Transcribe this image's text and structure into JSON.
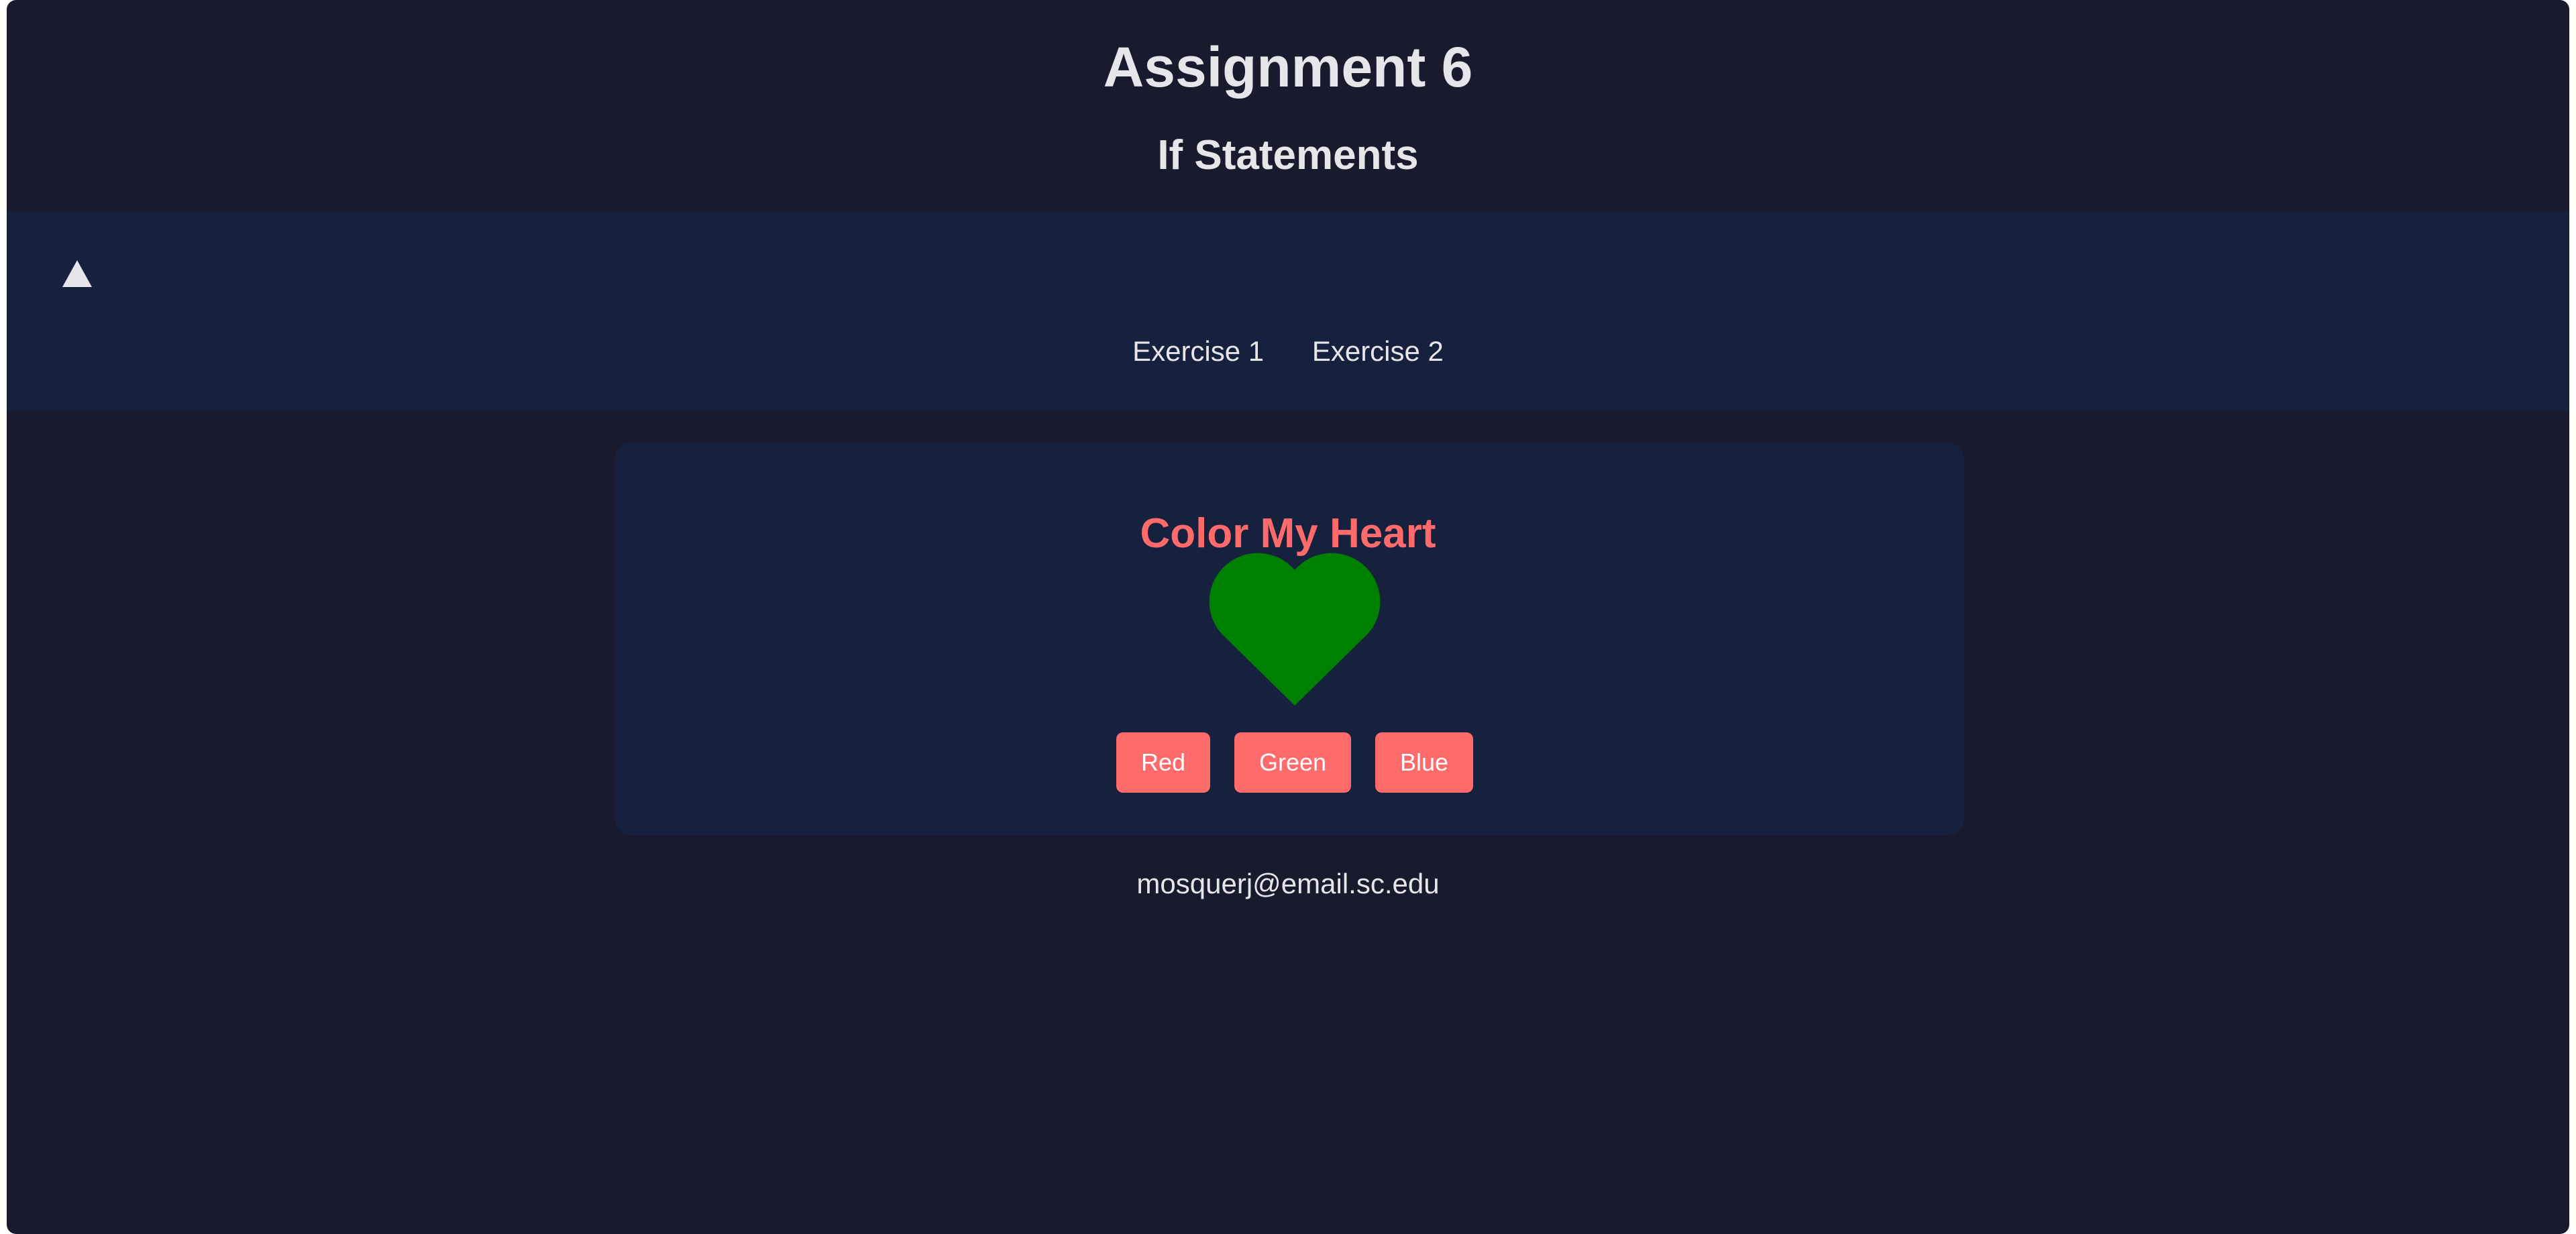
{
  "header": {
    "title": "Assignment 6",
    "subtitle": "If Statements"
  },
  "nav": {
    "toggle_icon": "triangle-up-icon",
    "links": [
      {
        "label": "Exercise 1"
      },
      {
        "label": "Exercise 2"
      }
    ]
  },
  "exercise": {
    "title": "Color My Heart",
    "heart_color": "#008000",
    "buttons": {
      "red": "Red",
      "green": "Green",
      "blue": "Blue"
    }
  },
  "footer": {
    "email": "mosquerj@email.sc.edu"
  },
  "colors": {
    "background": "#1a1a2e",
    "panel": "#16213e",
    "accent": "#ff6b6b",
    "text": "#e6e6ea"
  }
}
